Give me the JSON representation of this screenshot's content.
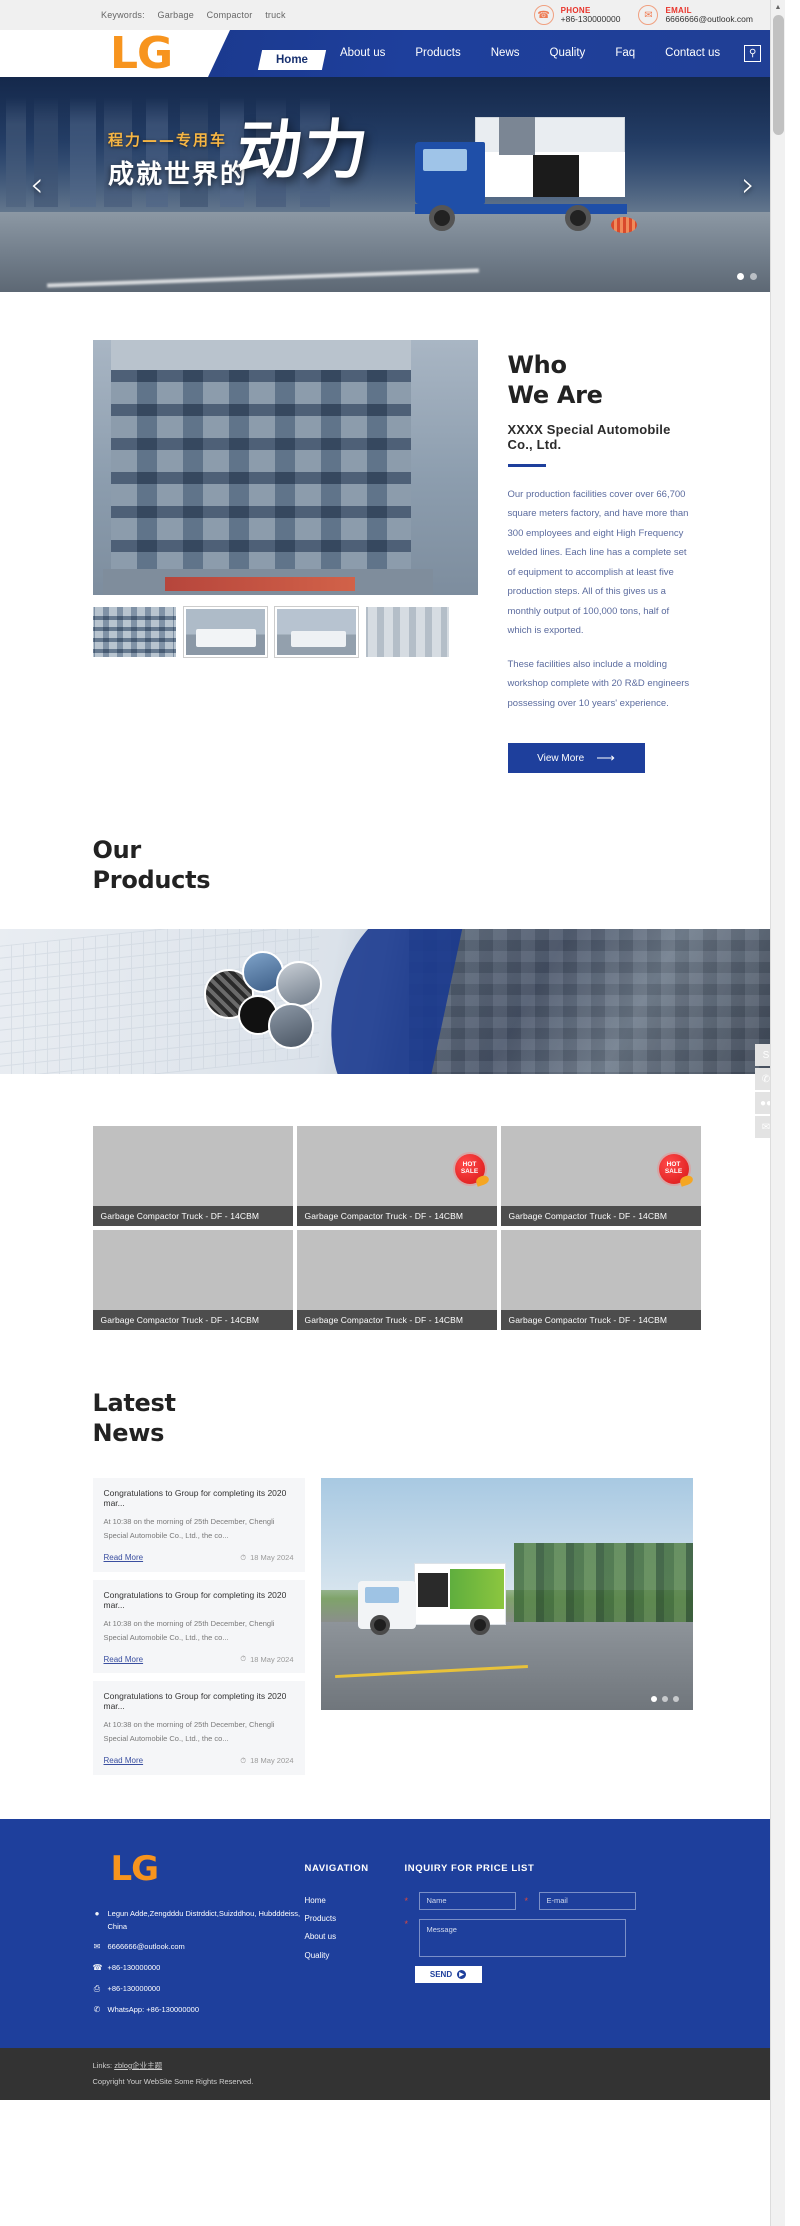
{
  "topbar": {
    "keywords_label": "Keywords:",
    "keywords": [
      "Garbage",
      "Compactor",
      "truck"
    ],
    "phone": {
      "label": "PHONE",
      "value": "+86-130000000",
      "icon": "phone-icon"
    },
    "email": {
      "label": "EMAIL",
      "value": "6666666@outlook.com",
      "icon": "email-icon"
    }
  },
  "header": {
    "logo": "LG",
    "nav": [
      "Home",
      "About us",
      "Products",
      "News",
      "Quality",
      "Faq",
      "Contact us"
    ],
    "active_nav": "Home",
    "search_icon": "search-icon"
  },
  "hero": {
    "line1": "程力——专用车",
    "line2": "成就世界的",
    "big": "动力",
    "prev": "‹",
    "next": "›",
    "dots": 2,
    "active_dot": 0
  },
  "about": {
    "title_line1": "Who",
    "title_line2": "We Are",
    "subtitle": "XXXX Special Automobile Co., Ltd.",
    "paragraphs": [
      "Our production facilities cover over 66,700 square meters factory, and have more than 300 employees and eight High Frequency welded lines. Each line has a complete set of equipment to accomplish at least five production steps. All of this gives us a monthly output of 100,000 tons, half of which is exported.",
      "These facilities also include a molding workshop complete with 20 R&D engineers possessing over 10 years' experience."
    ],
    "button": "View More",
    "button_arrow": "⟶",
    "thumbs": [
      "factory-building",
      "truck-front",
      "truck-side",
      "workshop"
    ],
    "selected_thumb": 1
  },
  "products": {
    "title_line1": "Our",
    "title_line2": "Products",
    "items": [
      {
        "caption": "Garbage Compactor Truck - DF - 14CBM",
        "badge": null
      },
      {
        "caption": "Garbage Compactor Truck - DF - 14CBM",
        "badge": "HOT SALE"
      },
      {
        "caption": "Garbage Compactor Truck - DF - 14CBM",
        "badge": "HOT SALE"
      },
      {
        "caption": "Garbage Compactor Truck - DF - 14CBM",
        "badge": null
      },
      {
        "caption": "Garbage Compactor Truck - DF - 14CBM",
        "badge": null
      },
      {
        "caption": "Garbage Compactor Truck - DF - 14CBM",
        "badge": null
      }
    ],
    "badge_line1": "HOT",
    "badge_line2": "SALE"
  },
  "news": {
    "title_line1": "Latest",
    "title_line2": "News",
    "read_more": "Read More",
    "clock_icon": "clock-icon",
    "items": [
      {
        "title": "Congratulations to Group for completing its 2020 mar...",
        "desc": "At 10:38 on the morning of 25th December, Chengli Special Automobile Co., Ltd., the co...",
        "date": "18 May 2024"
      },
      {
        "title": "Congratulations to Group for completing its 2020 mar...",
        "desc": "At 10:38 on the morning of 25th December, Chengli Special Automobile Co., Ltd., the co...",
        "date": "18 May 2024"
      },
      {
        "title": "Congratulations to Group for completing its 2020 mar...",
        "desc": "At 10:38 on the morning of 25th December, Chengli Special Automobile Co., Ltd., the co...",
        "date": "18 May 2024"
      }
    ],
    "slider_dots": 3,
    "slider_active": 0
  },
  "floatbar": [
    {
      "name": "skype-icon",
      "glyph": "S"
    },
    {
      "name": "whatsapp-icon",
      "glyph": "✆"
    },
    {
      "name": "wechat-icon",
      "glyph": "●●"
    },
    {
      "name": "email-icon",
      "glyph": "✉"
    }
  ],
  "footer": {
    "logo": "LG",
    "address": "Legun Adde,Zengdddu Distrddict,Suizddhou, Hubdddeiss, China",
    "email": "6666666@outlook.com",
    "phone": "+86-130000000",
    "fax": "+86-130000000",
    "whatsapp": "WhatsApp: +86-130000000",
    "icons": {
      "address": "location-pin-icon",
      "email": "envelope-icon",
      "phone": "phone-icon",
      "fax": "printer-icon",
      "whatsapp": "whatsapp-icon"
    },
    "nav_heading": "NAVIGATION",
    "nav_items": [
      "Home",
      "Products",
      "About us",
      "Quality"
    ],
    "form_heading": "INQUIRY FOR PRICE LIST",
    "name_placeholder": "Name",
    "email_placeholder": "E-mail",
    "message_placeholder": "Message",
    "send_label": "SEND",
    "send_arrow": "▶",
    "required_mark": "*"
  },
  "copyright": {
    "links_label": "Links:",
    "link_text": "zblog企业主题",
    "text": "Copyright Your WebSite Some Rights Reserved."
  },
  "colors": {
    "brand_blue": "#1e3f9c",
    "brand_orange": "#f7941e",
    "accent_red": "#e8342b",
    "footer_dark": "#333333"
  }
}
